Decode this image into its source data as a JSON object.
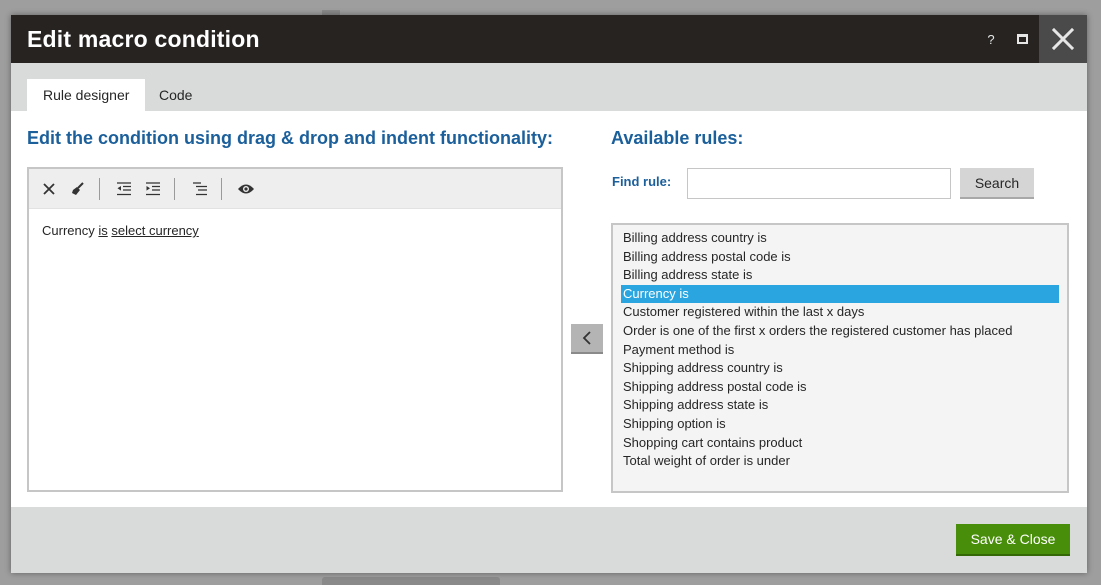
{
  "dialog": {
    "title": "Edit macro condition",
    "help_label": "?"
  },
  "tabs": [
    {
      "label": "Rule designer"
    },
    {
      "label": "Code"
    }
  ],
  "left": {
    "heading": "Edit the condition using drag & drop and indent functionality:",
    "toolbar_icons": [
      "delete-icon",
      "clear-icon",
      "unindent-icon",
      "indent-icon",
      "autoindent-icon",
      "preview-icon"
    ],
    "condition": {
      "prefix": "Currency",
      "operator": "is",
      "value": "select currency"
    }
  },
  "right": {
    "heading": "Available rules:",
    "find_label": "Find rule:",
    "find_value": "",
    "search_label": "Search",
    "rules": [
      "Billing address country is",
      "Billing address postal code is",
      "Billing address state is",
      "Currency is",
      "Customer registered within the last x days",
      "Order is one of the first x orders the registered customer has placed",
      "Payment method is",
      "Shipping address country is",
      "Shipping address postal code is",
      "Shipping address state is",
      "Shipping option is",
      "Shopping cart contains product",
      "Total weight of order is under"
    ],
    "selected_rule": "Currency is"
  },
  "footer": {
    "save_label": "Save & Close"
  },
  "colors": {
    "heading": "#1b5f9b",
    "selected": "#2ba5df",
    "save": "#498e0b",
    "titlebar": "#262321"
  }
}
